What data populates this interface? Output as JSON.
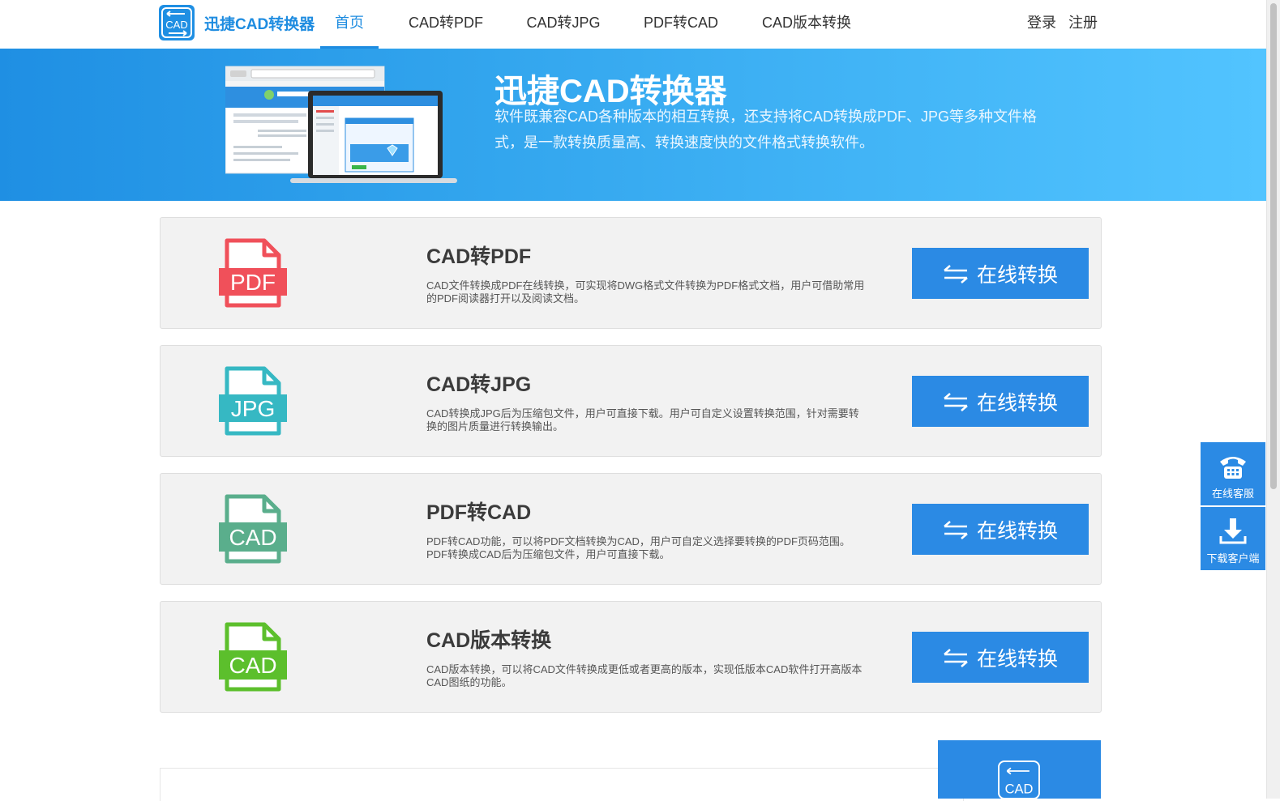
{
  "header": {
    "brand": "迅捷CAD转换器",
    "logo_text": "CAD",
    "nav": [
      {
        "label": "首页",
        "active": true
      },
      {
        "label": "CAD转PDF",
        "active": false
      },
      {
        "label": "CAD转JPG",
        "active": false
      },
      {
        "label": "PDF转CAD",
        "active": false
      },
      {
        "label": "CAD版本转换",
        "active": false
      }
    ],
    "login": "登录",
    "register": "注册"
  },
  "banner": {
    "title": "迅捷CAD转换器",
    "description": "软件既兼容CAD各种版本的相互转换，还支持将CAD转换成PDF、JPG等多种文件格式，是一款转换质量高、转换速度快的文件格式转换软件。"
  },
  "features": [
    {
      "icon": "pdf-file-icon",
      "icon_label": "PDF",
      "color": "#f0505a",
      "title": "CAD转PDF",
      "description": "CAD文件转换成PDF在线转换，可实现将DWG格式文件转换为PDF格式文档，用户可借助常用的PDF阅读器打开以及阅读文档。",
      "button": "在线转换"
    },
    {
      "icon": "jpg-file-icon",
      "icon_label": "JPG",
      "color": "#36b8c3",
      "title": "CAD转JPG",
      "description": "CAD转换成JPG后为压缩包文件，用户可直接下载。用户可自定义设置转换范围，针对需要转换的图片质量进行转换输出。",
      "button": "在线转换"
    },
    {
      "icon": "cad-file-icon",
      "icon_label": "CAD",
      "color": "#5aae8c",
      "title": "PDF转CAD",
      "description": "PDF转CAD功能，可以将PDF文档转换为CAD，用户可自定义选择要转换的PDF页码范围。PDF转换成CAD后为压缩包文件，用户可直接下载。",
      "button": "在线转换"
    },
    {
      "icon": "cad-file-icon",
      "icon_label": "CAD",
      "color": "#5cbf2c",
      "title": "CAD版本转换",
      "description": "CAD版本转换，可以将CAD文件转换成更低或者更高的版本，实现低版本CAD软件打开高版本CAD图纸的功能。",
      "button": "在线转换"
    }
  ],
  "side": {
    "service": "在线客服",
    "download": "下载客户端"
  },
  "footer": {
    "logo_text": "CAD"
  },
  "colors": {
    "accent": "#1e8ce0",
    "button": "#2b8ae4"
  }
}
